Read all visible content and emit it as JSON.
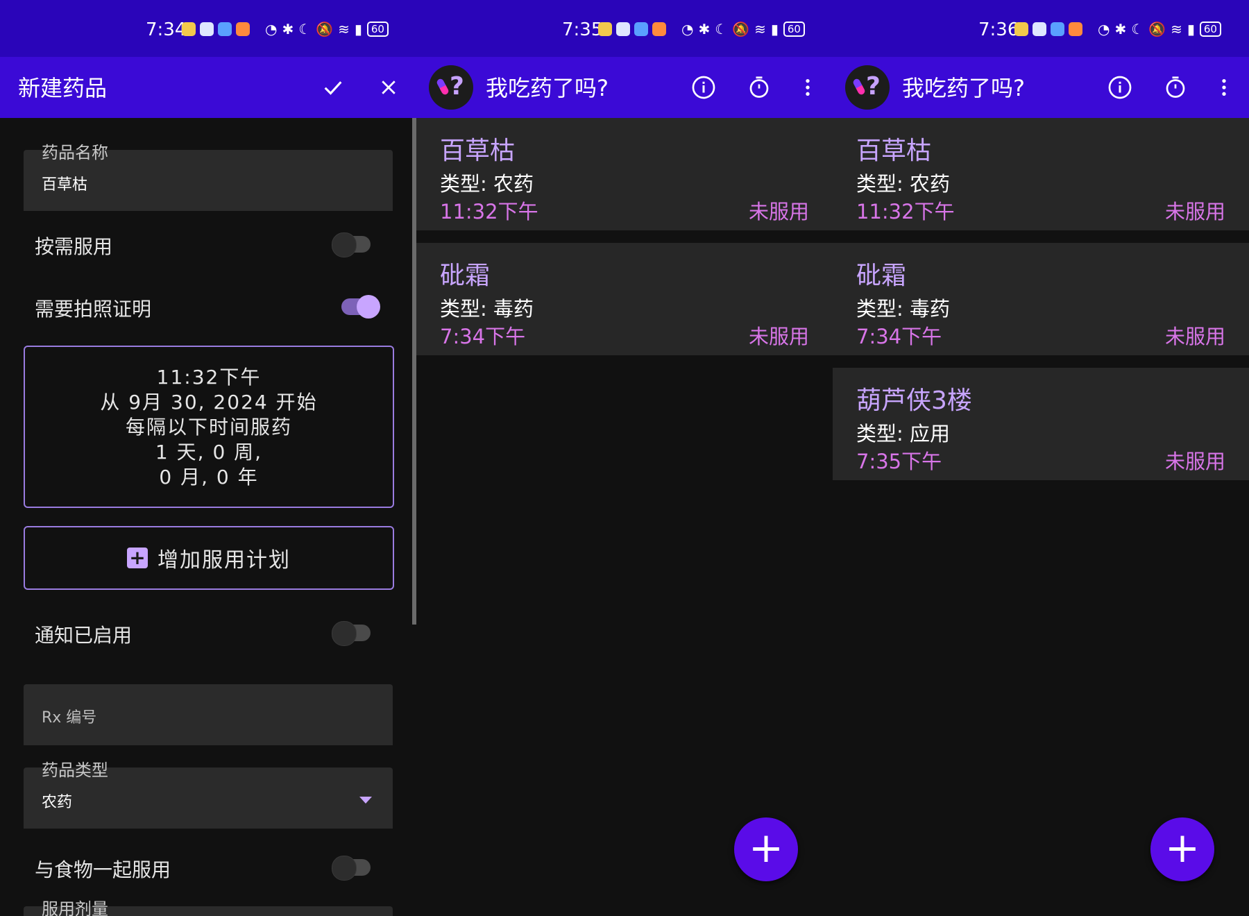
{
  "screens": [
    {
      "status_time": "7:34",
      "battery": "60",
      "appbar_title": "新建药品",
      "form": {
        "name_label": "药品名称",
        "name_value": "百草枯",
        "as_needed_label": "按需服用",
        "photo_proof_label": "需要拍照证明",
        "schedule_lines": [
          "11:32下午",
          "从 9月 30, 2024 开始",
          "每隔以下时间服药",
          "1 天, 0 周,",
          "0 月, 0 年"
        ],
        "add_schedule_label": "增加服用计划",
        "notifications_label": "通知已启用",
        "rx_placeholder": "Rx 编号",
        "type_label": "药品类型",
        "type_value": "农药",
        "with_food_label": "与食物一起服用",
        "dosage_label": "服用剂量"
      }
    },
    {
      "status_time": "7:35",
      "battery": "60",
      "appbar_title": "我吃药了吗?",
      "medicines": [
        {
          "name": "百草枯",
          "type": "类型: 农药",
          "time": "11:32下午",
          "status": "未服用"
        },
        {
          "name": "砒霜",
          "type": "类型: 毒药",
          "time": "7:34下午",
          "status": "未服用"
        }
      ],
      "fab": "+"
    },
    {
      "status_time": "7:36",
      "battery": "60",
      "appbar_title": "我吃药了吗?",
      "medicines": [
        {
          "name": "百草枯",
          "type": "类型: 农药",
          "time": "11:32下午",
          "status": "未服用"
        },
        {
          "name": "砒霜",
          "type": "类型: 毒药",
          "time": "7:34下午",
          "status": "未服用"
        },
        {
          "name": "葫芦侠3楼",
          "type": "类型: 应用",
          "time": "7:35下午",
          "status": "未服用"
        }
      ],
      "fab": "+"
    }
  ],
  "icons": {
    "confirm": "check-icon",
    "close": "close-icon",
    "info": "info-icon",
    "timer": "timer-icon",
    "menu": "more-vert-icon"
  },
  "colors": {
    "status_bar": "#2a05b9",
    "app_bar": "#3b0ad6",
    "accent": "#c8a5ff",
    "time_text": "#d875e8",
    "fab": "#5a0ce8",
    "background": "#111111",
    "card": "#272727"
  }
}
